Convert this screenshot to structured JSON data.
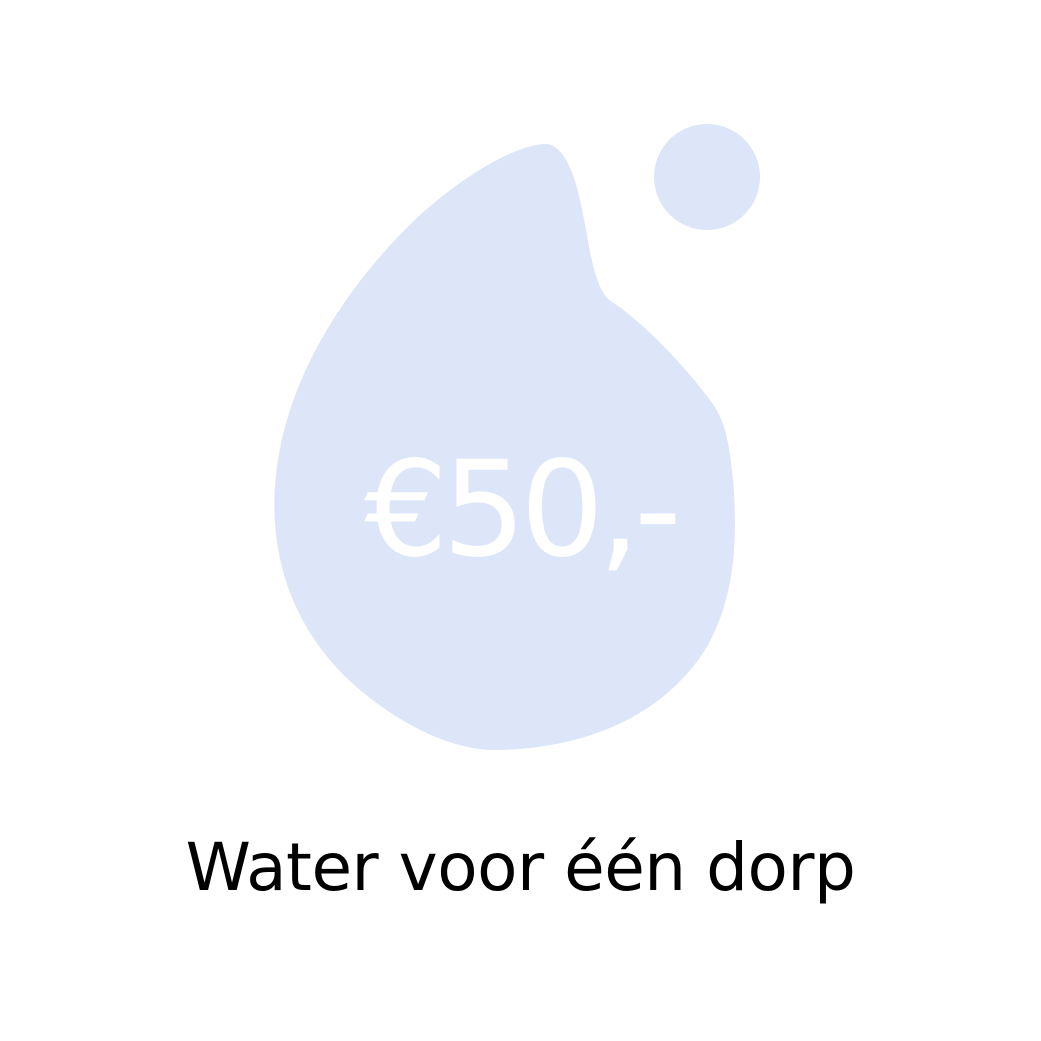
{
  "card": {
    "price": "€50,-",
    "caption": "Water voor één dorp",
    "drop_icon": "water-drop-icon",
    "bubble_icon": "water-bubble-icon"
  },
  "colors": {
    "background": "#ffffff",
    "drop": "#dce6f8",
    "price_text": "#ffffff",
    "caption_text": "#000000"
  }
}
